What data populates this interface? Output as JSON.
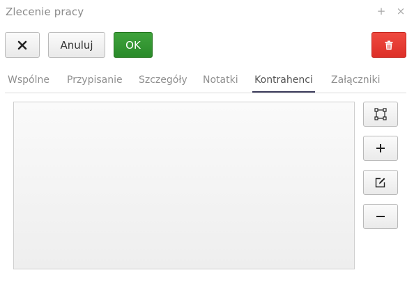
{
  "window": {
    "title": "Zlecenie pracy",
    "plus_icon": "plus-icon",
    "close_icon": "close-icon"
  },
  "toolbar": {
    "close_icon": "x-icon",
    "cancel_label": "Anuluj",
    "ok_label": "OK",
    "delete_icon": "trash-icon",
    "ok_color": "#2e8f2c",
    "delete_color": "#e53a32"
  },
  "tabs": [
    {
      "label": "Wspólne",
      "active": false
    },
    {
      "label": "Przypisanie",
      "active": false
    },
    {
      "label": "Szczegóły",
      "active": false
    },
    {
      "label": "Notatki",
      "active": false
    },
    {
      "label": "Kontrahenci",
      "active": true
    },
    {
      "label": "Załączniki",
      "active": false
    }
  ],
  "side_buttons": [
    {
      "icon": "expand-icon"
    },
    {
      "icon": "add-icon"
    },
    {
      "icon": "edit-icon"
    },
    {
      "icon": "remove-icon"
    }
  ]
}
